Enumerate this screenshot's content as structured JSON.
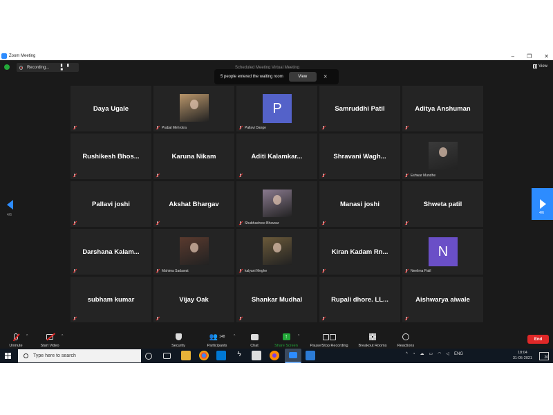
{
  "window": {
    "title": "Zoom Meeting",
    "minimize": "–",
    "maximize": "❐",
    "close": "✕"
  },
  "topbar": {
    "recording_label": "Recording...",
    "recording_controls": "▮▮ ■",
    "meeting_title": "Scheduled Meeting Virtual Meeting",
    "view_label": "View"
  },
  "toast": {
    "message": "5 people entered the waiting room",
    "view_button": "View",
    "close": "✕"
  },
  "participants": [
    {
      "name": "Daya Ugale",
      "video": "none"
    },
    {
      "name": "Prabal Mehrotra",
      "video": "photo",
      "bg": "#b8956a"
    },
    {
      "name": "Pallavi Dange",
      "video": "letter",
      "letter": "P",
      "color": "#5462c9"
    },
    {
      "name": "Samruddhi Patil",
      "video": "none"
    },
    {
      "name": "Aditya Anshuman",
      "video": "none"
    },
    {
      "name": "Rushikesh  Bhos...",
      "video": "none"
    },
    {
      "name": "Karuna Nikam",
      "video": "none"
    },
    {
      "name": "Aditi  Kalamkar...",
      "video": "none"
    },
    {
      "name": "Shravani  Wagh...",
      "video": "none"
    },
    {
      "name": "Eshwar Mundhe",
      "video": "photo",
      "bg": "#3a3a3a"
    },
    {
      "name": "Pallavi joshi",
      "video": "none"
    },
    {
      "name": "Akshat Bhargav",
      "video": "none"
    },
    {
      "name": "Shubhashree Bhavsar",
      "video": "photo",
      "bg": "#8a7a8f"
    },
    {
      "name": "Manasi joshi",
      "video": "none"
    },
    {
      "name": "Shweta patil",
      "video": "none"
    },
    {
      "name": "Darshana  Kalam...",
      "video": "none"
    },
    {
      "name": "Mahima Sadawat",
      "video": "photo",
      "bg": "#5a3a2e"
    },
    {
      "name": "kalyani Meghe",
      "video": "photo",
      "bg": "#6b5a3a"
    },
    {
      "name": "Kiran  Kadam  Rn...",
      "video": "none"
    },
    {
      "name": "Neelima Patil",
      "video": "letter",
      "letter": "N",
      "color": "#6a4fc7"
    },
    {
      "name": "subham kumar",
      "video": "none"
    },
    {
      "name": "Vijay Oak",
      "video": "none"
    },
    {
      "name": "Shankar Mudhal",
      "video": "none"
    },
    {
      "name": "Rupali dhore. LL...",
      "video": "none"
    },
    {
      "name": "Aishwarya aiwale",
      "video": "none"
    }
  ],
  "pagination": {
    "prev_page": "4/6",
    "next_page": "4/6"
  },
  "toolbar": {
    "unmute": "Unmute",
    "start_video": "Start Video",
    "security": "Security",
    "participants": "Participants",
    "participant_count": "148",
    "chat": "Chat",
    "share_screen": "Share Screen",
    "pause_stop": "Pause/Stop Recording",
    "breakout": "Breakout Rooms",
    "reactions": "Reactions",
    "end": "End",
    "caret": "^"
  },
  "taskbar": {
    "search_placeholder": "Type here to search",
    "language": "ENG",
    "time": "18:04",
    "date": "31-05-2021",
    "notifications": "20",
    "tray_up": "^"
  },
  "colors": {
    "accent": "#2d8cff",
    "end": "#e02828",
    "share": "#23a839"
  }
}
